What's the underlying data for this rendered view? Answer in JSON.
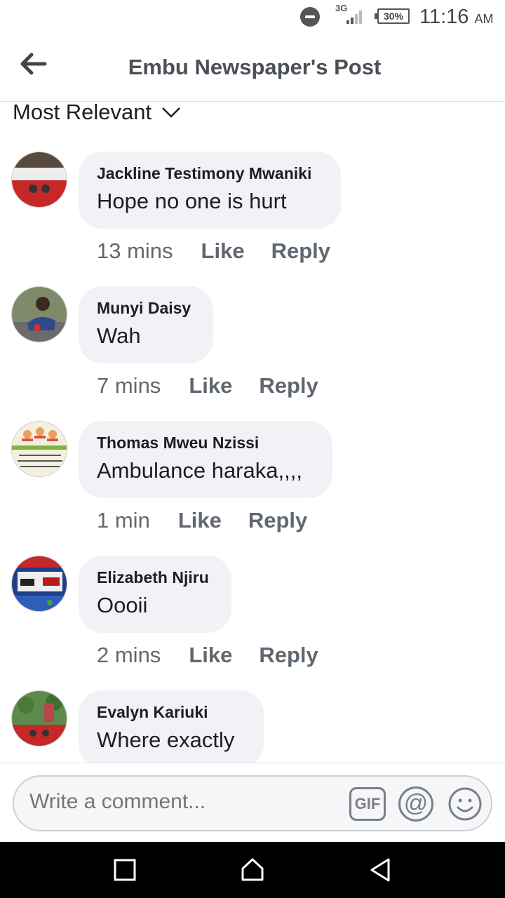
{
  "status_bar": {
    "network": "3G",
    "battery": "30%",
    "time": "11:16",
    "ampm": "AM"
  },
  "header": {
    "title": "Embu Newspaper's Post"
  },
  "sort": {
    "label": "Most Relevant"
  },
  "comments": [
    {
      "author": "Jackline Testimony Mwaniki",
      "text": "Hope no one is hurt",
      "time": "13 mins",
      "like": "Like",
      "reply": "Reply"
    },
    {
      "author": "Munyi Daisy",
      "text": "Wah",
      "time": "7 mins",
      "like": "Like",
      "reply": "Reply"
    },
    {
      "author": "Thomas Mweu Nzissi",
      "text": "Ambulance haraka,,,,",
      "time": "1 min",
      "like": "Like",
      "reply": "Reply"
    },
    {
      "author": "Elizabeth Njiru",
      "text": "Oooii",
      "time": "2 mins",
      "like": "Like",
      "reply": "Reply"
    },
    {
      "author": "Evalyn Kariuki",
      "text": "Where exactly",
      "time": "",
      "like": "",
      "reply": ""
    }
  ],
  "composer": {
    "placeholder": "Write a comment...",
    "gif_label": "GIF",
    "at_label": "@"
  },
  "icons": {
    "back": "arrow-left-icon",
    "sort": "chevron-down-icon",
    "gif": "gif-icon",
    "mention": "at-icon",
    "emoji": "smiley-icon",
    "nav_recents": "square-icon",
    "nav_home": "home-icon",
    "nav_back": "triangle-back-icon"
  },
  "colors": {
    "bubble": "#f0f2f5",
    "text": "#1c1e21",
    "meta": "#65676b",
    "navbar": "#000000"
  }
}
